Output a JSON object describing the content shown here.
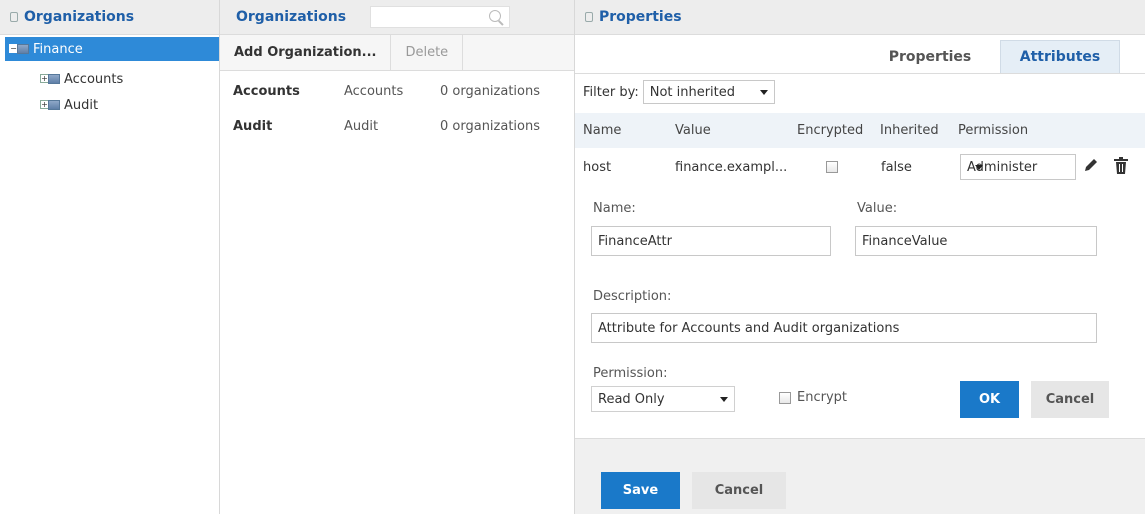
{
  "left_panel": {
    "title": "Organizations",
    "tree": [
      {
        "label": "Finance",
        "selected": true,
        "toggle": "−"
      },
      {
        "label": "Accounts",
        "selected": false,
        "toggle": "+"
      },
      {
        "label": "Audit",
        "selected": false,
        "toggle": "+"
      }
    ]
  },
  "mid_panel": {
    "title": "Organizations",
    "search_placeholder": "",
    "toolbar": {
      "add_label": "Add Organization...",
      "delete_label": "Delete"
    },
    "rows": [
      {
        "name": "Accounts",
        "description": "Accounts",
        "count": "0 organizations"
      },
      {
        "name": "Audit",
        "description": "Audit",
        "count": "0 organizations"
      }
    ]
  },
  "right_panel": {
    "title": "Properties",
    "tabs": {
      "properties": "Properties",
      "attributes": "Attributes",
      "active": "Attributes"
    },
    "filter": {
      "label": "Filter by:",
      "value": "Not inherited"
    },
    "columns": {
      "name": "Name",
      "value": "Value",
      "encrypted": "Encrypted",
      "inherited": "Inherited",
      "permission": "Permission"
    },
    "row": {
      "name": "host",
      "value": "finance.exampl...",
      "encrypted": false,
      "inherited": "false",
      "permission": "Administer"
    },
    "form": {
      "name_label": "Name:",
      "name_value": "FinanceAttr",
      "value_label": "Value:",
      "value_value": "FinanceValue",
      "description_label": "Description:",
      "description_value": "Attribute for Accounts and Audit organizations",
      "permission_label": "Permission:",
      "permission_value": "Read Only",
      "encrypt_label": "Encrypt",
      "ok_label": "OK",
      "cancel_label": "Cancel"
    },
    "footer": {
      "save_label": "Save",
      "cancel_label": "Cancel"
    }
  },
  "colors": {
    "accent": "#1a79c9",
    "selected_row": "#2e8ad8",
    "title_text": "#1f5fa8"
  }
}
